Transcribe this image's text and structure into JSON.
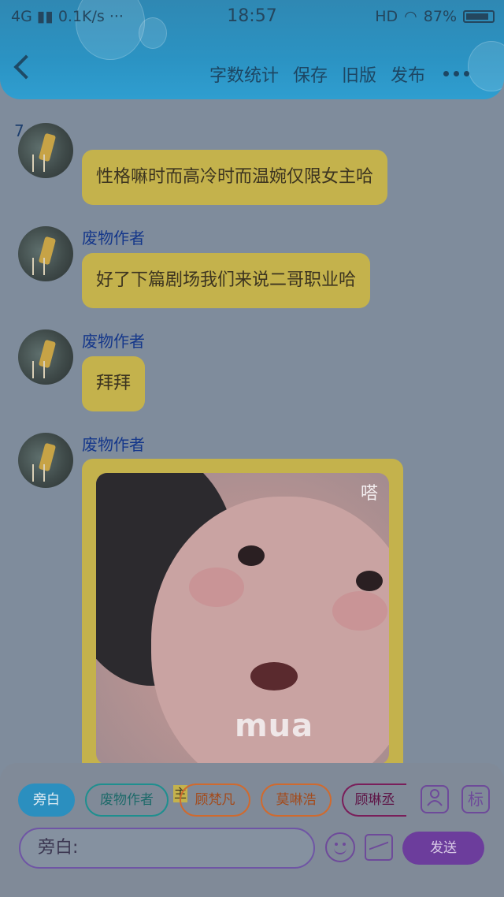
{
  "status_bar": {
    "network": "4G",
    "speed": "0.1K/s ···",
    "time": "18:57",
    "hd": "HD",
    "battery": "87%"
  },
  "header": {
    "actions": [
      "字数统计",
      "保存",
      "旧版",
      "发布"
    ]
  },
  "content": {
    "count": "7",
    "messages": [
      {
        "author": "",
        "text": "性格嘛时而高冷时而温婉仅限女主哈"
      },
      {
        "author": "废物作者",
        "text": "好了下篇剧场我们来说二哥职业哈"
      },
      {
        "author": "废物作者",
        "text": "拜拜"
      },
      {
        "author": "废物作者",
        "image_caption": "mua",
        "image_tag": "嗒"
      }
    ]
  },
  "toolbar": {
    "roles": [
      {
        "label": "旁白",
        "active": true,
        "color": "#2b8fbf"
      },
      {
        "label": "废物作者",
        "active": false,
        "color": "#1e8f8f"
      },
      {
        "label": "顾梵凡",
        "active": false,
        "color": "#d06a2e"
      },
      {
        "label": "莫啉浩",
        "active": false,
        "color": "#d06a2e"
      },
      {
        "label": "顾琳丞",
        "active": false,
        "color": "#7a1e5a"
      }
    ],
    "selected_marker": "主",
    "mark_button": "标",
    "input_value": "旁白:",
    "send_label": "发送"
  }
}
